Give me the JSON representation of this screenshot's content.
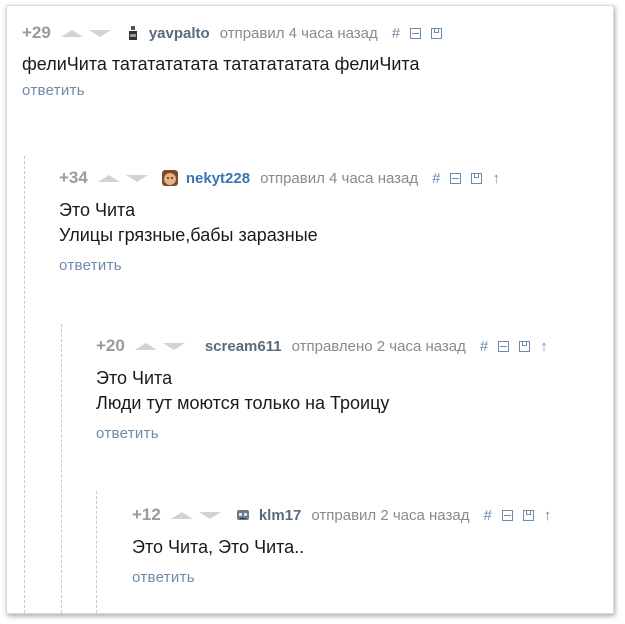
{
  "comments": [
    {
      "rating": "+29",
      "username": "yavpalto",
      "username_color": "#5b6b7c",
      "avatar": "bottle-avatar",
      "timestamp": "отправил 4 часа назад",
      "lines": [
        "фелиЧита тататататата тататататата фелиЧита"
      ],
      "reply": "ответить",
      "has_parent_link": false
    },
    {
      "rating": "+34",
      "username": "nekyt228",
      "username_color": "#3a73b5",
      "avatar": "face-avatar",
      "timestamp": "отправил 4 часа назад",
      "lines": [
        "Это Чита",
        "Улицы грязные,бабы заразные"
      ],
      "reply": "ответить",
      "has_parent_link": true
    },
    {
      "rating": "+20",
      "username": "scream611",
      "username_color": "#5b6b7c",
      "avatar": "",
      "timestamp": "отправлено 2 часа назад",
      "lines": [
        "Это Чита",
        "Люди тут моются только на Троицу"
      ],
      "reply": "ответить",
      "has_parent_link": true
    },
    {
      "rating": "+12",
      "username": "klm17",
      "username_color": "#5b6b7c",
      "avatar": "robot-avatar",
      "timestamp": "отправил 2 часа назад",
      "lines": [
        "Это Чита, Это Чита.."
      ],
      "reply": "ответить",
      "has_parent_link": true
    }
  ],
  "tools": {
    "hash": "#",
    "minus": "collapse-icon",
    "save": "save-icon",
    "parent": "↑"
  },
  "colors": {
    "link": "#6d8bab",
    "muted": "#8a8a8a",
    "rating": "#9a9a9a",
    "vote_arrow": "#d3d3d3"
  }
}
